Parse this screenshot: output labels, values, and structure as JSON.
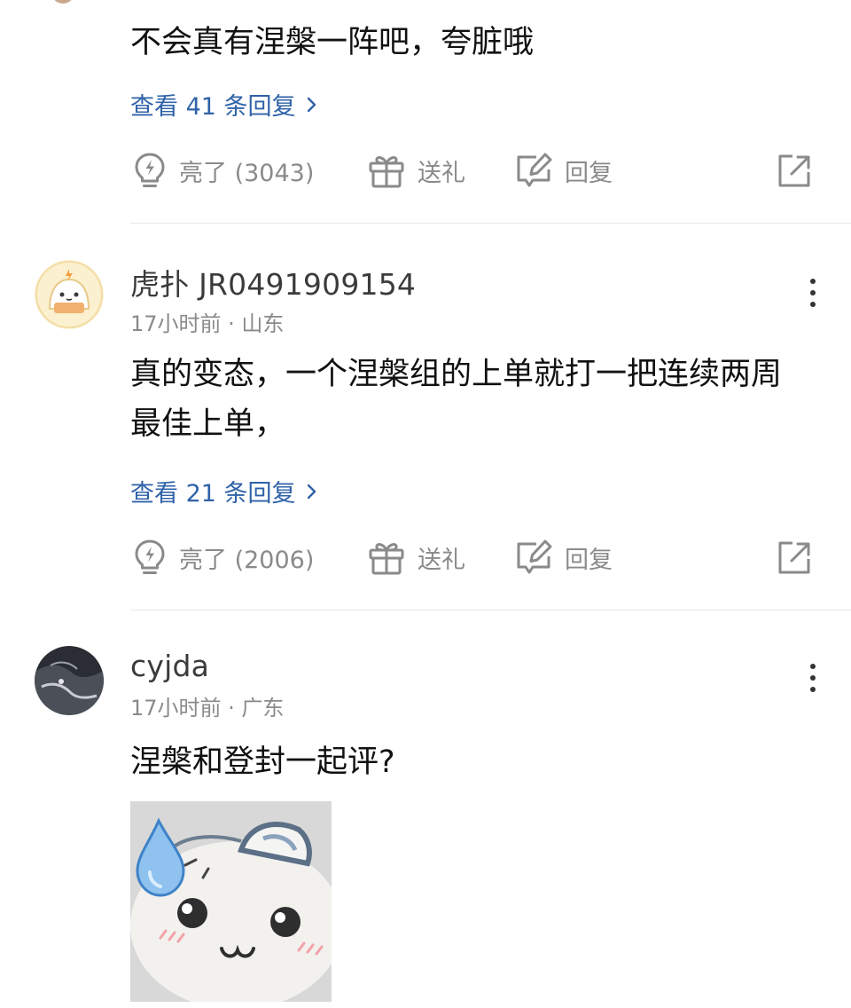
{
  "comments": [
    {
      "body": "不会真有涅槃一阵吧，夸脏哦",
      "replies_link": "查看 41 条回复",
      "actions": {
        "like_label": "亮了 (3043)",
        "gift_label": "送礼",
        "reply_label": "回复"
      }
    },
    {
      "username": "虎扑 JR0491909154",
      "meta": "17小时前 · 山东",
      "body": "真的变态，一个涅槃组的上单就打一把连续两周最佳上单，",
      "replies_link": "查看 21 条回复",
      "actions": {
        "like_label": "亮了 (2006)",
        "gift_label": "送礼",
        "reply_label": "回复"
      }
    },
    {
      "username": "cyjda",
      "meta": "17小时前 · 广东",
      "body": "涅槃和登封一起评?",
      "sticker": "crying-cat-sticker"
    }
  ],
  "icons": {
    "like": "lightbulb-lightning-icon",
    "gift": "gift-icon",
    "reply": "edit-reply-icon",
    "share": "share-external-icon",
    "more": "more-vertical-icon"
  },
  "colors": {
    "text": "#111111",
    "username": "#3b3b3b",
    "meta": "#8a8a8a",
    "link": "#2f62a8",
    "divider": "#e9e9e9"
  }
}
